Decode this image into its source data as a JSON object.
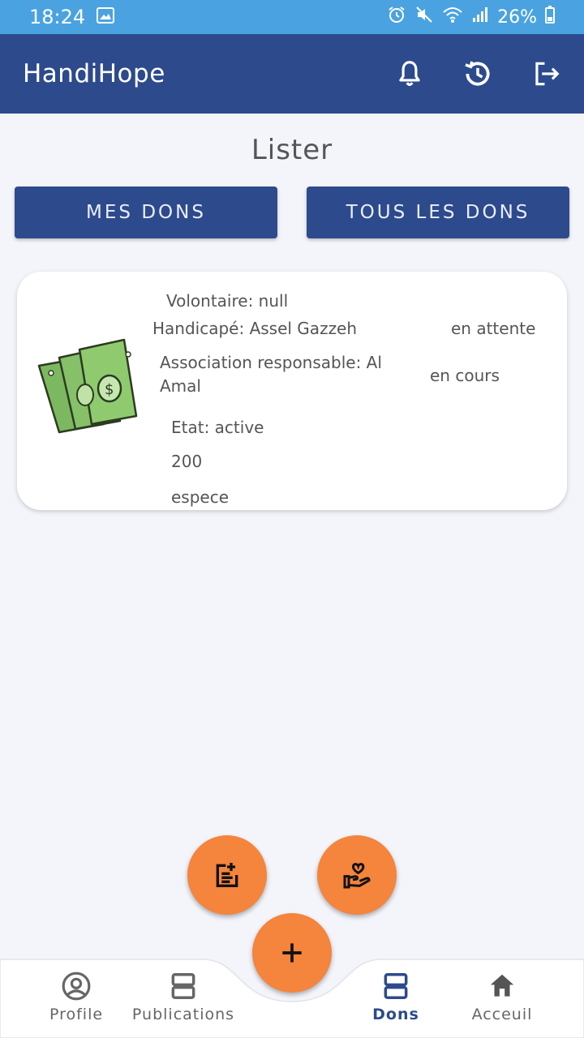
{
  "status": {
    "time": "18:24",
    "battery": "26%"
  },
  "app": {
    "title": "HandiHope"
  },
  "page": {
    "title": "Lister"
  },
  "buttons": {
    "mes_dons": "MES DONS",
    "tous_les_dons": "TOUS LES DONS"
  },
  "card": {
    "volontaire": "Volontaire: null",
    "handicape": "Handicapé: Assel Gazzeh",
    "status1": "en attente",
    "association": "Association responsable: Al Amal",
    "status2": "en cours",
    "etat": "Etat: active",
    "montant": "200",
    "type": "espece"
  },
  "nav": {
    "items": [
      {
        "label": "Profile",
        "icon": "account-circle-icon"
      },
      {
        "label": "Publications",
        "icon": "publications-icon"
      },
      {
        "label": "Dons",
        "icon": "dons-icon"
      },
      {
        "label": "Acceuil",
        "icon": "home-icon"
      }
    ]
  },
  "colors": {
    "primary": "#2d4a8c",
    "accent": "#f5843c",
    "status_bar": "#4aa3e0",
    "background": "#f3f5fb"
  }
}
